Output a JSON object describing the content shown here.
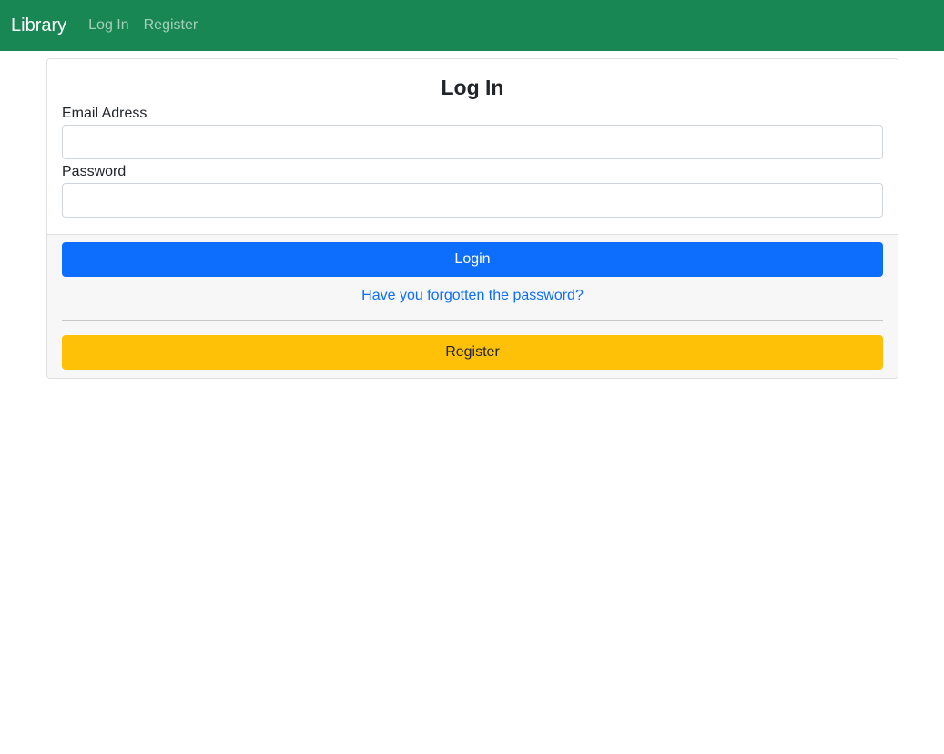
{
  "navbar": {
    "brand": "Library",
    "links": [
      "Log In",
      "Register"
    ]
  },
  "login_card": {
    "title": "Log In",
    "email_label": "Email Adress",
    "email_value": "",
    "password_label": "Password",
    "password_value": "",
    "login_button": "Login",
    "forgot_link": "Have you forgotten the password?",
    "register_button": "Register"
  },
  "colors": {
    "navbar_bg": "#198754",
    "primary": "#0d6efd",
    "warning": "#ffc107"
  }
}
